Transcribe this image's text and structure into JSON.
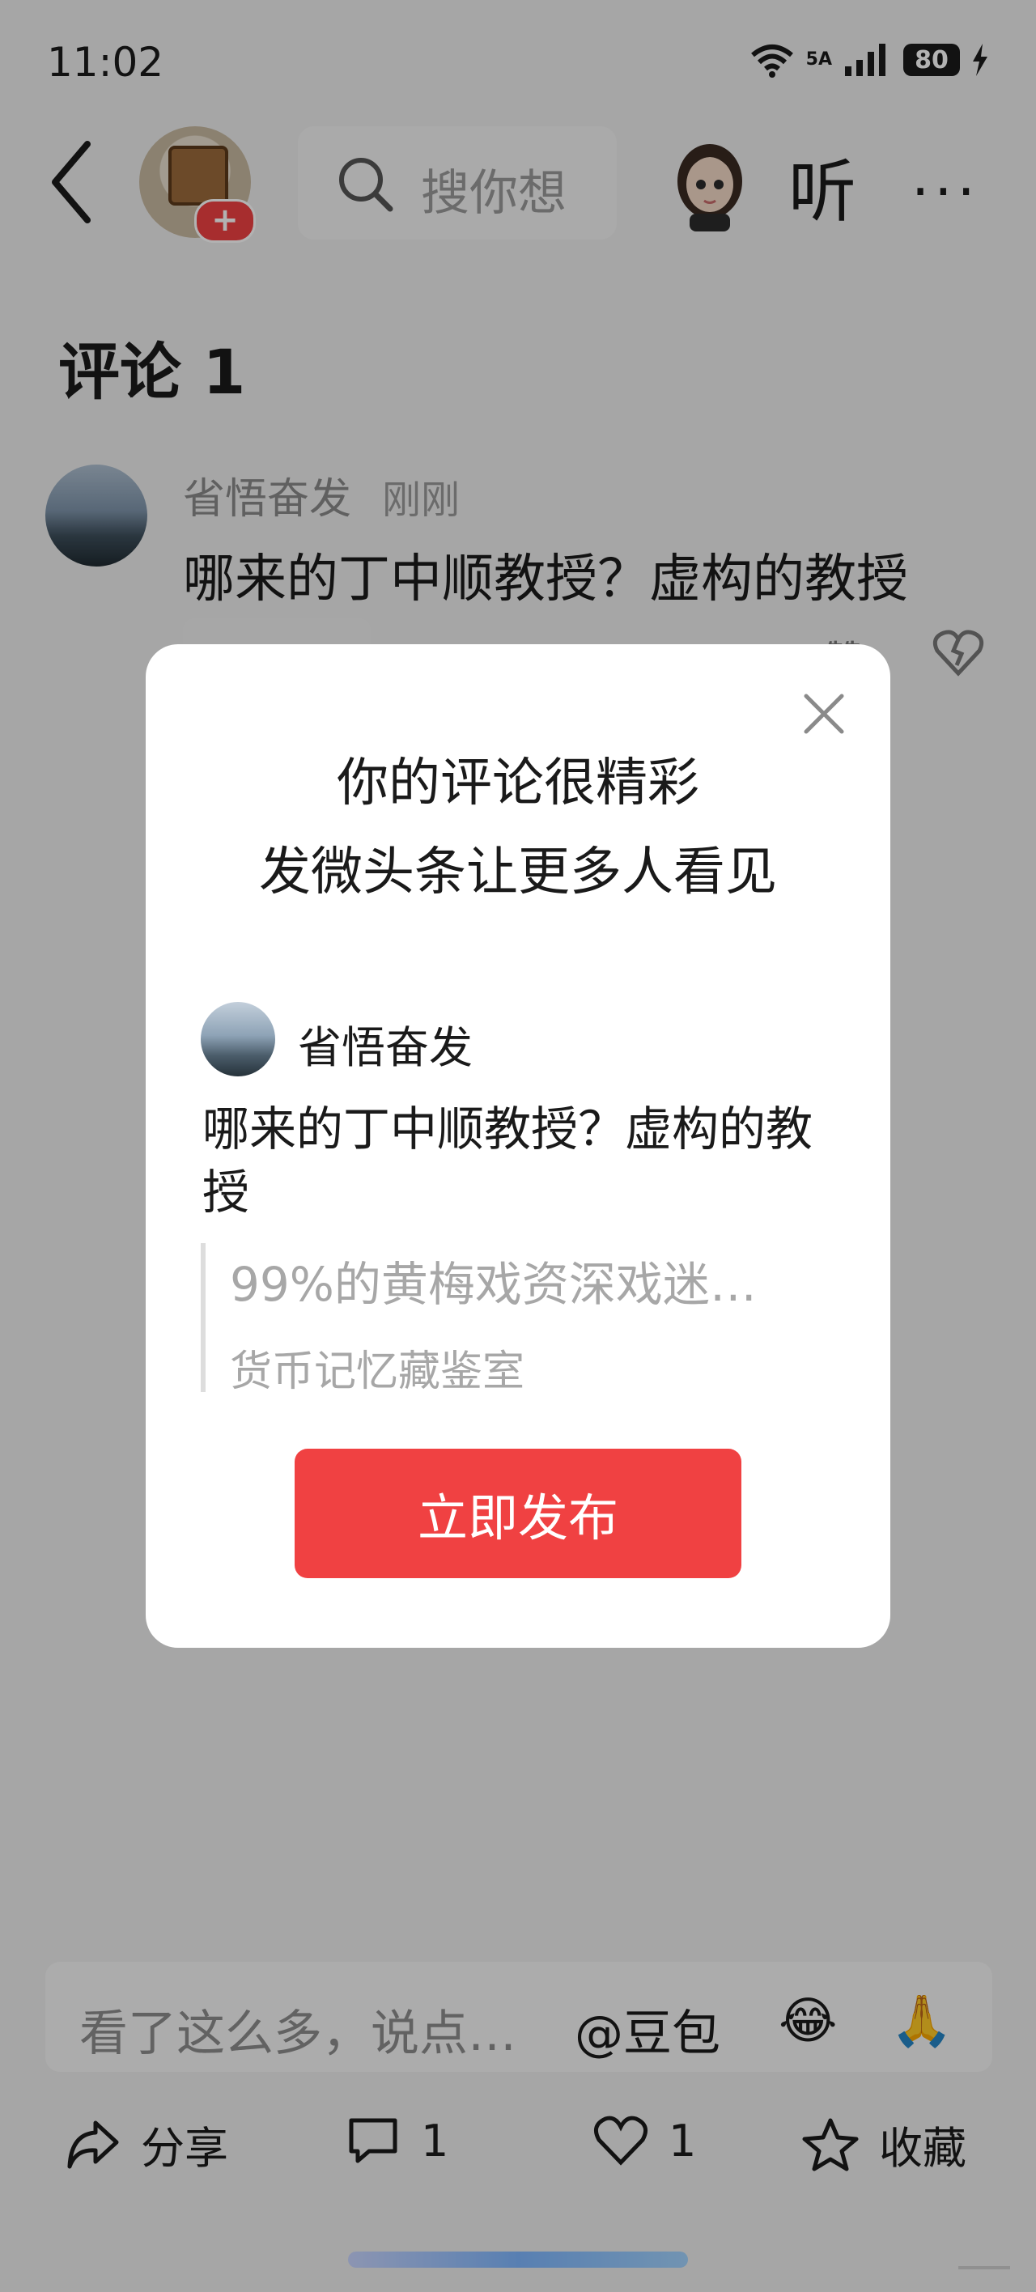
{
  "status_bar": {
    "time": "11:02",
    "network": "5A",
    "battery": "80"
  },
  "top_nav": {
    "search_placeholder": "搜你想",
    "listen_label": "听",
    "more_label": "···"
  },
  "comments": {
    "title": "评论 1",
    "items": [
      {
        "user": "省悟奋发",
        "time": "刚刚",
        "text": "哪来的丁中顺教授？虚构的教授",
        "like_label": "赞"
      }
    ]
  },
  "modal": {
    "line1": "你的评论很精彩",
    "line2": "发微头条让更多人看见",
    "user": "省悟奋发",
    "text": "哪来的丁中顺教授？虚构的教授",
    "quote_title": "99%的黄梅戏资深戏迷…",
    "quote_source": "货币记忆藏鉴室",
    "publish_button": "立即发布"
  },
  "bottom_bar": {
    "input_placeholder": "看了这么多，说点…",
    "at_label": "@豆包",
    "share_label": "分享",
    "comment_count": "1",
    "like_count": "1",
    "favorite_label": "收藏"
  },
  "colors": {
    "accent": "#f04142",
    "overlay": "rgba(0,0,0,0.30)"
  }
}
